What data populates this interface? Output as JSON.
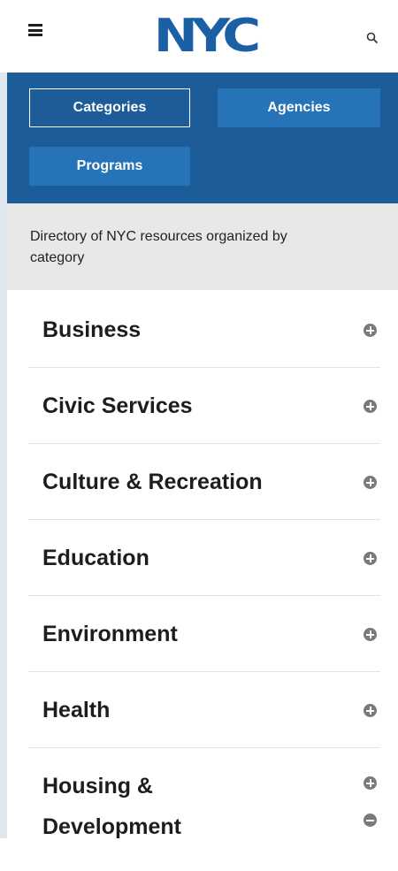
{
  "header": {
    "logo_text": "NYC",
    "menu_icon": "hamburger-menu-icon",
    "search_icon": "search-icon"
  },
  "nav": {
    "buttons": [
      {
        "label": "Categories",
        "active": true
      },
      {
        "label": "Agencies",
        "active": false
      },
      {
        "label": "Programs",
        "active": false
      }
    ]
  },
  "intro": {
    "text": "Directory of NYC resources organized by category"
  },
  "categories": [
    {
      "label": "Business",
      "icon": "plus-circle-icon"
    },
    {
      "label": "Civic Services",
      "icon": "plus-circle-icon"
    },
    {
      "label": "Culture & Recreation",
      "icon": "plus-circle-icon"
    },
    {
      "label": "Education",
      "icon": "plus-circle-icon"
    },
    {
      "label": "Environment",
      "icon": "plus-circle-icon"
    },
    {
      "label": "Health",
      "icon": "plus-circle-icon"
    },
    {
      "label": "Housing & Development",
      "icons": [
        "plus-circle-icon",
        "minus-circle-icon"
      ]
    }
  ],
  "colors": {
    "brand_blue": "#1b5fa5",
    "nav_background": "#1b5c99",
    "button_blue": "#2673b8",
    "intro_background": "#e8e8e8",
    "icon_gray": "#7a7a7a"
  }
}
